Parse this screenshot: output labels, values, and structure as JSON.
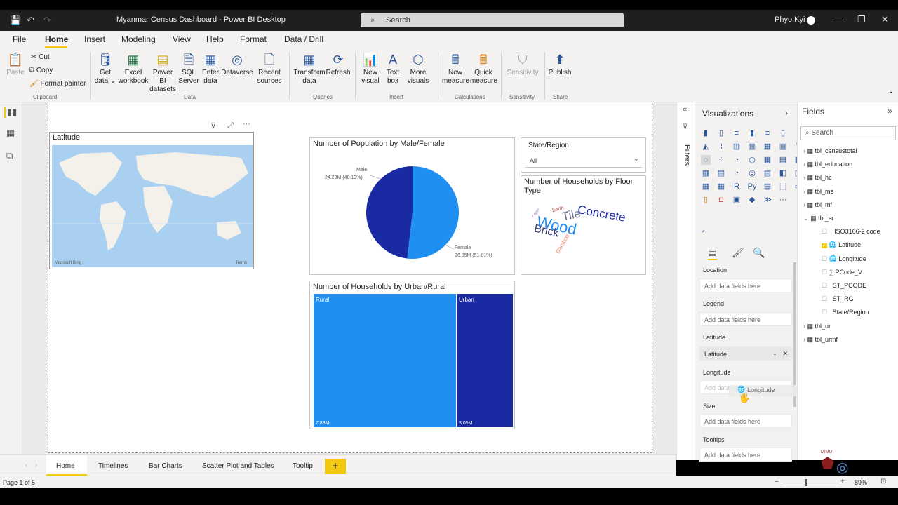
{
  "window": {
    "title": "Myanmar Census Dashboard - Power BI Desktop",
    "search_placeholder": "Search",
    "user": "Phyo Kyi"
  },
  "ribbon_tabs": [
    "File",
    "Home",
    "Insert",
    "Modeling",
    "View",
    "Help",
    "Format",
    "Data / Drill"
  ],
  "ribbon": {
    "paste": "Paste",
    "cut": "Cut",
    "copy": "Copy",
    "format_painter": "Format painter",
    "get_data": "Get data",
    "excel": "Excel workbook",
    "pbi_datasets": "Power BI datasets",
    "sql": "SQL Server",
    "enter_data": "Enter data",
    "dataverse": "Dataverse",
    "recent": "Recent sources",
    "transform": "Transform data",
    "refresh": "Refresh",
    "new_visual": "New visual",
    "text_box": "Text box",
    "more_visuals": "More visuals",
    "new_measure": "New measure",
    "quick_measure": "Quick measure",
    "sensitivity": "Sensitivity",
    "publish": "Publish",
    "groups": [
      "Clipboard",
      "Data",
      "Queries",
      "Insert",
      "Calculations",
      "Sensitivity",
      "Share"
    ]
  },
  "visuals": {
    "map": {
      "title": "Latitude",
      "attribution": "Microsoft Bing",
      "terms": "Terms"
    },
    "pie": {
      "title": "Number of Population by Male/Female",
      "male_label": "Male",
      "male_value": "24.23M (48.19%)",
      "female_label": "Female",
      "female_value": "26.05M (51.81%)"
    },
    "slicer": {
      "title": "State/Region",
      "value": "All"
    },
    "wordcloud": {
      "title": "Number of Households by Floor Type",
      "words": [
        "Concrete",
        "Tile",
        "Wood",
        "Brick",
        "Earth",
        "Bamboo",
        "Other"
      ]
    },
    "treemap": {
      "title": "Number of Households by Urban/Rural",
      "rural_label": "Rural",
      "rural_value": "7.83M",
      "urban_label": "Urban",
      "urban_value": "3.05M"
    }
  },
  "chart_data": [
    {
      "type": "pie",
      "title": "Number of Population by Male/Female",
      "categories": [
        "Male",
        "Female"
      ],
      "values": [
        24.23,
        26.05
      ],
      "percent": [
        48.19,
        51.81
      ],
      "unit": "M",
      "colors": [
        "#1a2aa3",
        "#1f8ff2"
      ]
    },
    {
      "type": "treemap",
      "title": "Number of Households by Urban/Rural",
      "categories": [
        "Rural",
        "Urban"
      ],
      "values": [
        7.83,
        3.05
      ],
      "unit": "M",
      "colors": [
        "#1f8ff2",
        "#1a2aa3"
      ]
    }
  ],
  "filters_label": "Filters",
  "visualizations": {
    "title": "Visualizations",
    "wells": [
      {
        "label": "Location",
        "value": "Add data fields here"
      },
      {
        "label": "Legend",
        "value": "Add data fields here"
      },
      {
        "label": "Latitude",
        "value": "Latitude"
      },
      {
        "label": "Longitude",
        "value": "Add data fields here"
      },
      {
        "label": "Size",
        "value": "Add data fields here"
      },
      {
        "label": "Tooltips",
        "value": "Add data fields here"
      }
    ],
    "drag_ghost": "Longitude"
  },
  "fields": {
    "title": "Fields",
    "search_placeholder": "Search",
    "tables_top": [
      "tbl_censustotal",
      "tbl_education",
      "tbl_hc",
      "tbl_me",
      "tbl_mf"
    ],
    "expanded_table": "tbl_sr",
    "expanded_fields": [
      "ISO3166-2 code",
      "Latitude",
      "Longitude",
      "PCode_V",
      "ST_PCODE",
      "ST_RG",
      "State/Region"
    ],
    "tables_bottom": [
      "tbl_ur",
      "tbl_urmf"
    ]
  },
  "page_tabs": [
    "Home",
    "Timelines",
    "Bar Charts",
    "Scatter Plot and Tables",
    "Tooltip"
  ],
  "status": {
    "page": "Page 1 of 5",
    "zoom": "89%"
  },
  "watermark": "MIMU"
}
